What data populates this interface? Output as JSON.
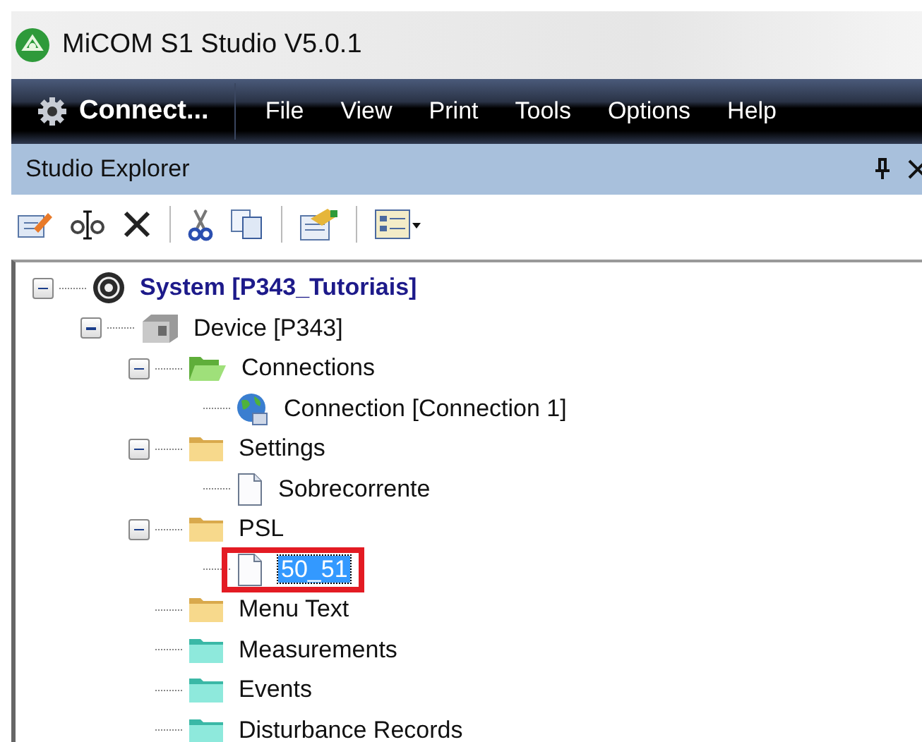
{
  "window": {
    "title": "MiCOM S1 Studio V5.0.1"
  },
  "menu_bar": {
    "connect": "Connect...",
    "items": [
      "File",
      "View",
      "Print",
      "Tools",
      "Options",
      "Help"
    ]
  },
  "panel": {
    "title": "Studio Explorer"
  },
  "tree": [
    {
      "label": "System [P343_Tutoriais]",
      "kind": "system",
      "expanded": true,
      "selected": false,
      "children": [
        {
          "label": "Device [P343]",
          "kind": "device",
          "expanded": true,
          "selected": false,
          "children": [
            {
              "label": "Connections",
              "kind": "folder-open",
              "expanded": true,
              "selected": false,
              "children": [
                {
                  "label": "Connection [Connection 1]",
                  "kind": "globe",
                  "selected": false
                }
              ]
            },
            {
              "label": "Settings",
              "kind": "folder",
              "expanded": true,
              "selected": false,
              "children": [
                {
                  "label": "Sobrecorrente",
                  "kind": "document",
                  "selected": false
                }
              ]
            },
            {
              "label": "PSL",
              "kind": "folder",
              "expanded": true,
              "selected": false,
              "children": [
                {
                  "label": "50_51",
                  "kind": "document",
                  "selected": true,
                  "highlighted": true
                }
              ]
            },
            {
              "label": "Menu Text",
              "kind": "folder",
              "selected": false
            },
            {
              "label": "Measurements",
              "kind": "folder-teal",
              "selected": false
            },
            {
              "label": "Events",
              "kind": "folder-teal",
              "selected": false
            },
            {
              "label": "Disturbance Records",
              "kind": "folder-teal",
              "selected": false
            }
          ]
        }
      ]
    }
  ]
}
